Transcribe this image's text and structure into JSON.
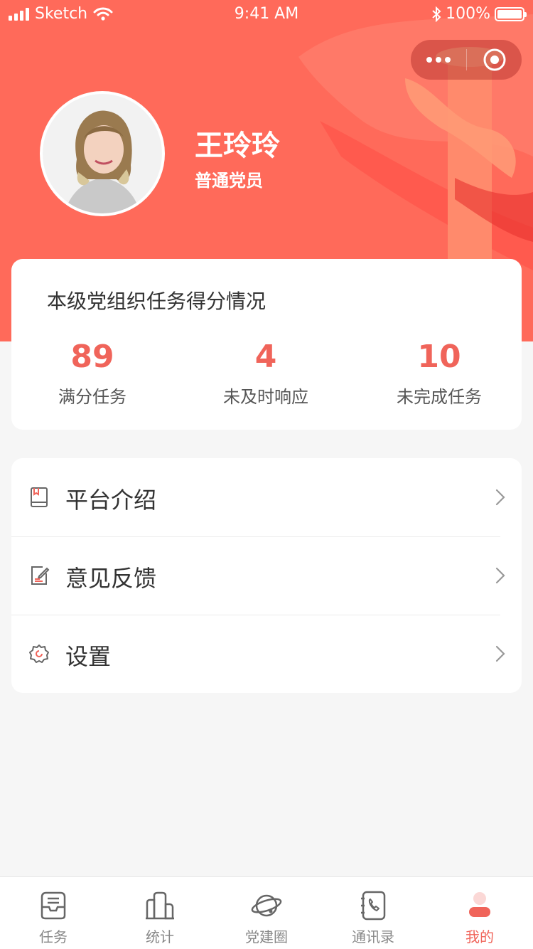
{
  "status_bar": {
    "carrier": "Sketch",
    "time": "9:41 AM",
    "battery": "100%"
  },
  "capsule": {
    "more_icon": "more-dots-icon",
    "close_icon": "target-close-icon"
  },
  "profile": {
    "name": "王玲玲",
    "role": "普通党员"
  },
  "score_card": {
    "title": "本级党组织任务得分情况",
    "items": [
      {
        "value": "89",
        "label": "满分任务"
      },
      {
        "value": "4",
        "label": "未及时响应"
      },
      {
        "value": "10",
        "label": "未完成任务"
      }
    ]
  },
  "menu": {
    "items": [
      {
        "label": "平台介绍",
        "icon": "book-icon"
      },
      {
        "label": "意见反馈",
        "icon": "feedback-edit-icon"
      },
      {
        "label": "设置",
        "icon": "settings-gear-icon"
      }
    ]
  },
  "tabbar": {
    "active_index": 4,
    "accent_color": "#f0645a",
    "items": [
      {
        "label": "任务",
        "icon": "inbox-icon"
      },
      {
        "label": "统计",
        "icon": "bar-chart-icon"
      },
      {
        "label": "党建圈",
        "icon": "planet-icon"
      },
      {
        "label": "通讯录",
        "icon": "contacts-phone-icon"
      },
      {
        "label": "我的",
        "icon": "person-icon"
      }
    ]
  },
  "colors": {
    "hero_background": "#ff6a5a",
    "accent": "#f0645a",
    "page_background": "#f6f6f6"
  }
}
